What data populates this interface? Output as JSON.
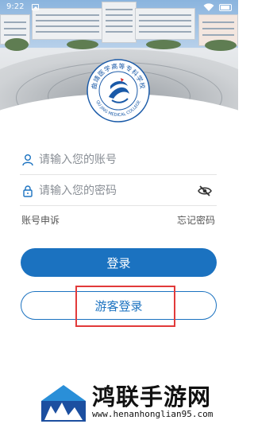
{
  "status_bar": {
    "time": "9:22"
  },
  "logo": {
    "ring_text_top": "曲靖医学高等专科学校",
    "ring_text_bottom": "QU JING MEDICAL COLLEGE",
    "colors": {
      "ring": "#1a5aa8",
      "accent": "#d72a2a"
    }
  },
  "form": {
    "account": {
      "placeholder": "请输入您的账号",
      "value": ""
    },
    "password": {
      "placeholder": "请输入您的密码",
      "value": ""
    }
  },
  "links": {
    "appeal": "账号申诉",
    "forgot": "忘记密码"
  },
  "buttons": {
    "login": "登录",
    "guest_login": "游客登录"
  },
  "watermark": {
    "title": "鸿联手游网",
    "url": "www.henanhonglian95.com"
  },
  "colors": {
    "primary": "#1b72c0",
    "annotation": "#e23a3a"
  },
  "icons": {
    "account": "user-icon",
    "password": "lock-icon",
    "password_toggle": "eye-off-icon",
    "status": [
      "picture-icon",
      "wifi-icon",
      "battery-icon"
    ]
  }
}
